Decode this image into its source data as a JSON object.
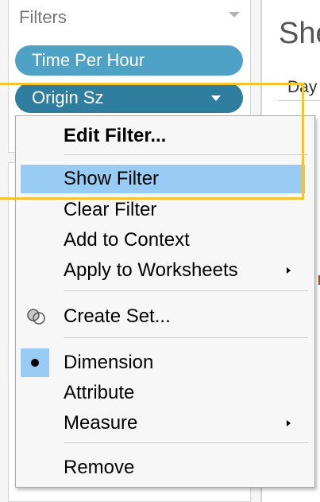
{
  "filters_panel": {
    "title": "Filters",
    "pills": [
      {
        "label": "Time Per Hour",
        "color": "#4ea2c6"
      },
      {
        "label": "Origin Sz",
        "color": "#2f7ea0"
      }
    ]
  },
  "worksheet": {
    "title_fragment": "She",
    "day_label": "Day"
  },
  "context_menu": {
    "items": {
      "edit_filter": "Edit Filter...",
      "show_filter": "Show Filter",
      "clear_filter": "Clear Filter",
      "add_to_context": "Add to Context",
      "apply_to_worksheets": "Apply to Worksheets",
      "create_set": "Create Set...",
      "dimension": "Dimension",
      "attribute": "Attribute",
      "measure": "Measure",
      "remove": "Remove"
    },
    "selected_role": "Dimension",
    "hover_item": "Show Filter"
  },
  "colors": {
    "highlight_outline": "#f4c430",
    "menu_hover": "#99ccf5",
    "pill_light": "#4ea2c6",
    "pill_dark": "#2f7ea0"
  }
}
